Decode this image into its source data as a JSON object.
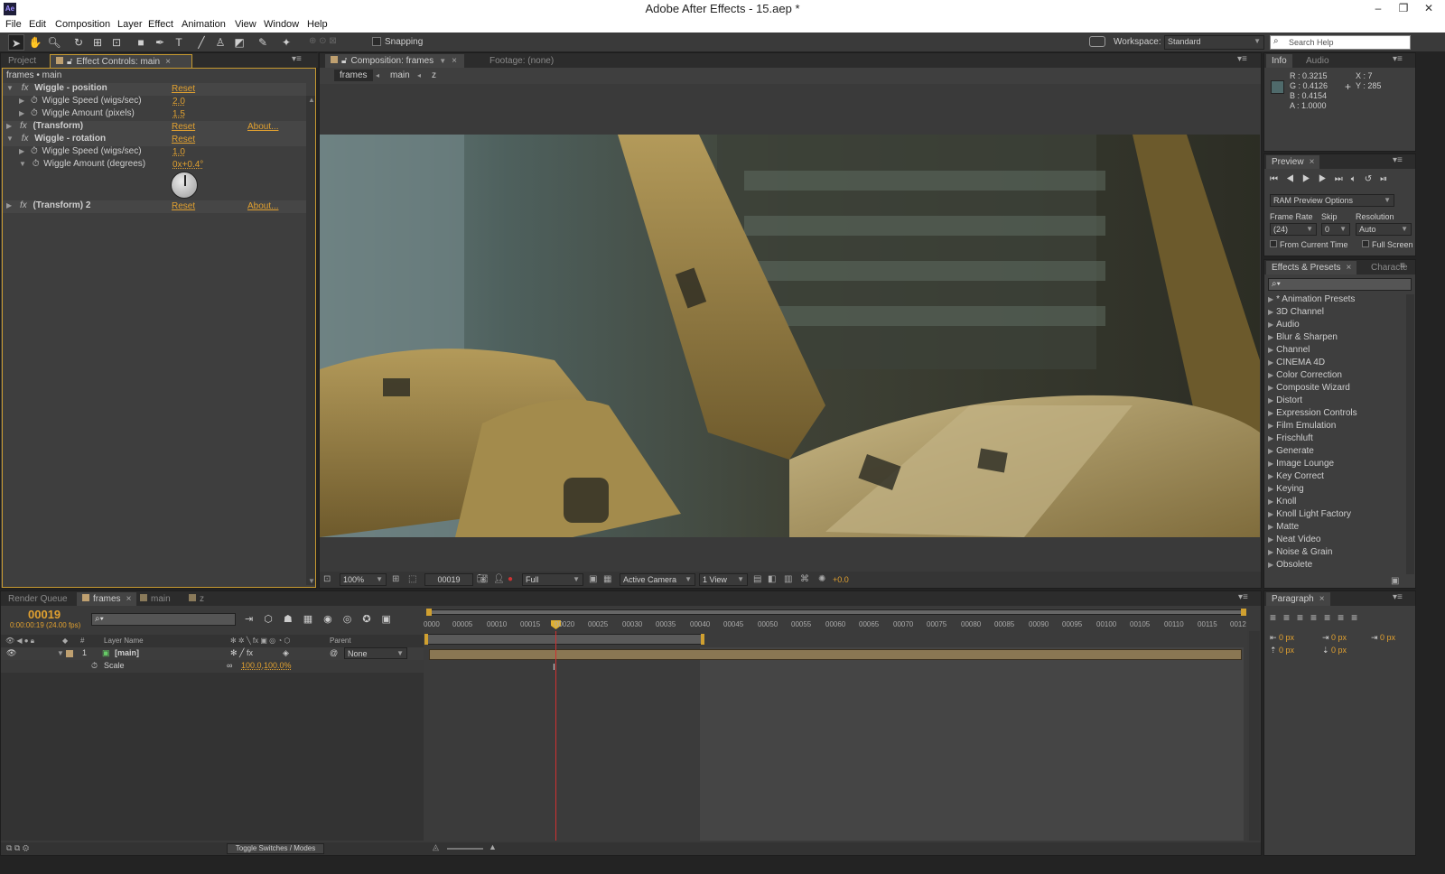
{
  "window": {
    "title": "Adobe After Effects - 15.aep *",
    "app_badge": "Ae"
  },
  "menu": [
    "File",
    "Edit",
    "Composition",
    "Layer",
    "Effect",
    "Animation",
    "View",
    "Window",
    "Help"
  ],
  "toolbar": {
    "snapping": "Snapping",
    "workspace_label": "Workspace:",
    "workspace_value": "Standard",
    "search_placeholder": "Search Help"
  },
  "left_panel": {
    "tabs": {
      "project": "Project",
      "effect_controls": "Effect Controls: main"
    },
    "breadcrumb": "frames • main",
    "effects": [
      {
        "name": "Wiggle - position",
        "reset": "Reset",
        "about": ""
      },
      {
        "name": "Wiggle Speed (wigs/sec)",
        "value": "2.0"
      },
      {
        "name": "Wiggle Amount (pixels)",
        "value": "1.5"
      },
      {
        "name": "(Transform)",
        "reset": "Reset",
        "about": "About..."
      },
      {
        "name": "Wiggle - rotation",
        "reset": "Reset",
        "about": ""
      },
      {
        "name": "Wiggle Speed (wigs/sec)",
        "value": "1.0"
      },
      {
        "name": "Wiggle Amount (degrees)",
        "value": "0x+0.4°"
      },
      {
        "name": "(Transform) 2",
        "reset": "Reset",
        "about": "About..."
      }
    ]
  },
  "composition": {
    "tabs": {
      "comp": "Composition: frames",
      "footage": "Footage: (none)"
    },
    "crumbs": [
      "frames",
      "main",
      "z"
    ],
    "footer": {
      "zoom": "100%",
      "timecode": "00019",
      "resolution": "Full",
      "camera": "Active Camera",
      "view": "1 View",
      "exposure": "+0.0"
    }
  },
  "info": {
    "tabs": {
      "info": "Info",
      "audio": "Audio"
    },
    "r": "R : 0.3215",
    "g": "G : 0.4126",
    "b": "B : 0.4154",
    "a": "A : 1.0000",
    "x": "X : 7",
    "y": "Y : 285",
    "swatch": "#4f6a6b"
  },
  "preview": {
    "tab": "Preview",
    "ram_options": "RAM Preview Options",
    "frame_rate_label": "Frame Rate",
    "skip_label": "Skip",
    "resolution_label": "Resolution",
    "frame_rate": "(24)",
    "skip": "0",
    "resolution": "Auto",
    "from_current": "From Current Time",
    "full_screen": "Full Screen"
  },
  "effects_presets": {
    "tabs": {
      "effects": "Effects & Presets",
      "character": "Characte"
    },
    "items": [
      "* Animation Presets",
      "3D Channel",
      "Audio",
      "Blur & Sharpen",
      "Channel",
      "CINEMA 4D",
      "Color Correction",
      "Composite Wizard",
      "Distort",
      "Expression Controls",
      "Film Emulation",
      "Frischluft",
      "Generate",
      "Image Lounge",
      "Key Correct",
      "Keying",
      "Knoll",
      "Knoll Light Factory",
      "Matte",
      "Neat Video",
      "Noise & Grain",
      "Obsolete"
    ]
  },
  "timeline": {
    "tabs": {
      "render": "Render Queue",
      "frames": "frames",
      "main": "main",
      "z": "z"
    },
    "current_time": "00019",
    "time_sub": "0:00:00:19 (24.00 fps)",
    "col_num": "#",
    "col_layer": "Layer Name",
    "col_parent": "Parent",
    "layer": {
      "num": "1",
      "name": "[main]",
      "parent": "None"
    },
    "prop": {
      "name": "Scale",
      "value": "100.0,100.0%"
    },
    "ruler": [
      "0000",
      "00005",
      "00010",
      "00015",
      "00020",
      "00025",
      "00030",
      "00035",
      "00040",
      "00045",
      "00050",
      "00055",
      "00060",
      "00065",
      "00070",
      "00075",
      "00080",
      "00085",
      "00090",
      "00095",
      "00100",
      "00105",
      "00110",
      "00115",
      "0012"
    ],
    "toggle": "Toggle Switches / Modes"
  },
  "paragraph": {
    "tab": "Paragraph",
    "px": "0 px"
  }
}
